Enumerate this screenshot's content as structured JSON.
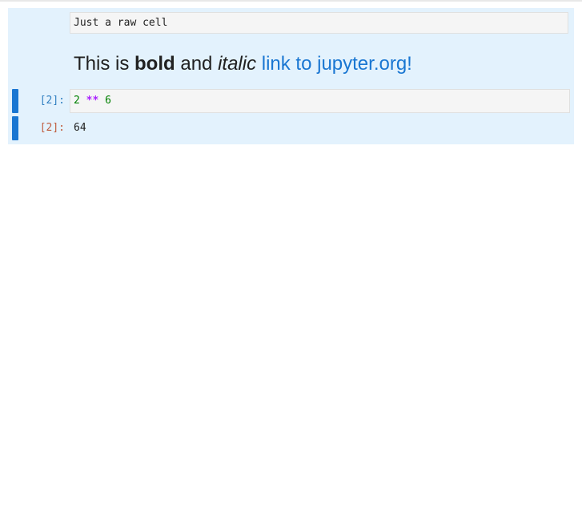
{
  "raw_cell": {
    "text": "Just a raw cell"
  },
  "markdown_cell": {
    "text_prefix": "This is ",
    "bold_text": "bold",
    "text_middle": " and ",
    "italic_text": "italic",
    "link_text": "link to jupyter.org!"
  },
  "code_cell": {
    "input_prompt": "[2]:",
    "code_tokens": [
      {
        "text": "2",
        "kind": "number"
      },
      {
        "text": " "
      },
      {
        "text": "**",
        "kind": "operator"
      },
      {
        "text": " "
      },
      {
        "text": "6",
        "kind": "number"
      }
    ],
    "output_prompt": "[2]:",
    "output_text": "64"
  },
  "colors": {
    "selection_background": "#e3f2fd",
    "collapser": "#1976d2",
    "input_prompt": "#307fc1",
    "output_prompt": "#bf5b3d",
    "link": "#1976d2"
  }
}
